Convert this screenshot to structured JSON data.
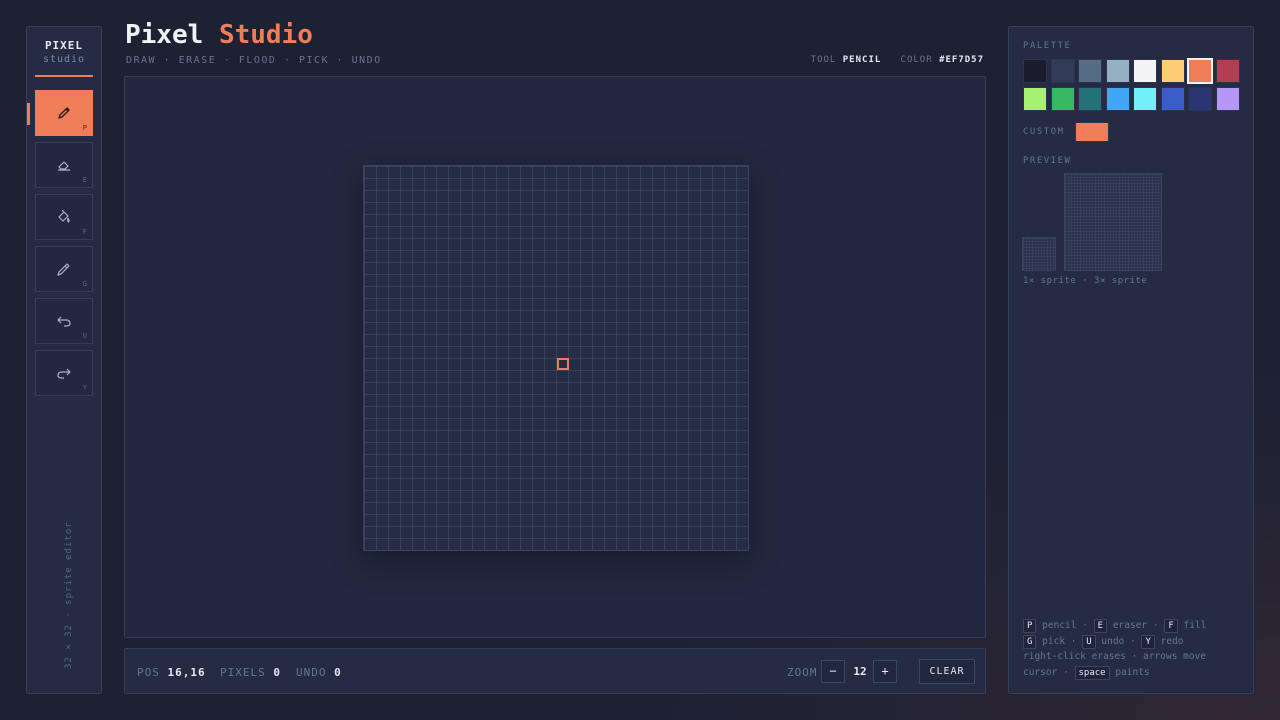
{
  "brand": {
    "title": "PIXEL",
    "subtitle": "studio"
  },
  "header": {
    "title_main": "Pixel",
    "title_accent": "Studio",
    "subtitle": "DRAW · ERASE · FLOOD · PICK · UNDO",
    "tool_label": "TOOL",
    "tool_value": "PENCIL",
    "color_label": "COLOR",
    "color_value": "#EF7D57"
  },
  "tools": [
    {
      "name": "pencil",
      "key": "P",
      "active": true
    },
    {
      "name": "eraser",
      "key": "E",
      "active": false
    },
    {
      "name": "fill",
      "key": "F",
      "active": false
    },
    {
      "name": "pick",
      "key": "G",
      "active": false
    },
    {
      "name": "undo",
      "key": "U",
      "active": false
    },
    {
      "name": "redo",
      "key": "Y",
      "active": false
    }
  ],
  "sidebar_caption": "32 × 32 · sprite editor",
  "canvas": {
    "grid_size": 32,
    "cursor": [
      16,
      16
    ]
  },
  "footer": {
    "pos_label": "POS",
    "pos_value": "16,16",
    "pixels_label": "PIXELS",
    "pixels_value": "0",
    "undo_label": "UNDO",
    "undo_value": "0",
    "zoom_label": "ZOOM",
    "zoom_minus": "−",
    "zoom_value": "12",
    "zoom_plus": "+",
    "clear_label": "CLEAR"
  },
  "palette": {
    "label": "PALETTE",
    "colors": [
      "#1a1c2c",
      "#333c57",
      "#566c86",
      "#94b0c2",
      "#f4f4f4",
      "#ffcd75",
      "#ef7d57",
      "#b13e53",
      "#a7f070",
      "#38b764",
      "#257179",
      "#41a6f6",
      "#73eff7",
      "#3b5dc9",
      "#29366f",
      "#b497f7"
    ],
    "selected_index": 6
  },
  "custom": {
    "label": "CUSTOM",
    "color": "#ef7d57"
  },
  "preview": {
    "label": "PREVIEW",
    "caption": "1× sprite · 3× sprite"
  },
  "shortcuts": {
    "k_p": "P",
    "t_pencil": "pencil ·",
    "k_e": "E",
    "t_eraser": "eraser ·",
    "k_f": "F",
    "t_fill": "fill",
    "k_g": "G",
    "t_pick": "pick ·",
    "k_u": "U",
    "t_undo": "undo ·",
    "k_y": "Y",
    "t_redo": "redo",
    "line3": "right-click erases · arrows move",
    "t_cursor": "cursor ·",
    "k_space": "space",
    "t_paints": "paints"
  }
}
